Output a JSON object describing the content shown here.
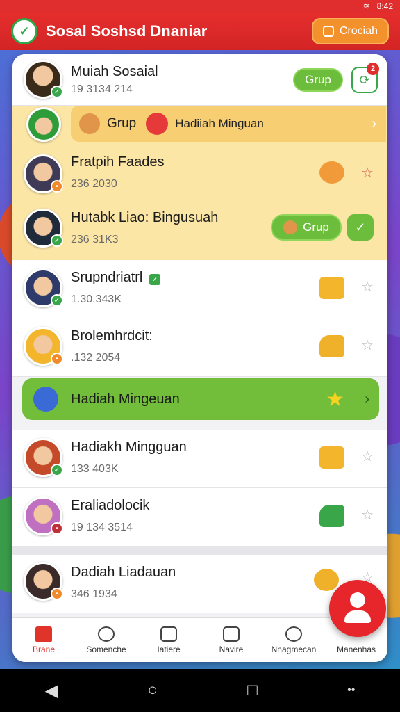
{
  "status": {
    "time": "8:42",
    "wifi_icon": "wifi-icon"
  },
  "app": {
    "title": "Sosal Soshsd Dnaniar",
    "create_label": "Crociah"
  },
  "profile": {
    "name": "Muiah Sosaial",
    "sub": "19 3134 214",
    "group_label": "Grup",
    "badge": "2"
  },
  "reward_bar": {
    "group_label": "Grup",
    "label": "Hadiiah Minguan"
  },
  "rows": [
    {
      "name": "Fratpih Faades",
      "sub": "236 2030"
    },
    {
      "name": "Hutabk Liao: Bingusuah",
      "sub": "236 31K3",
      "group_label": "Grup"
    },
    {
      "name": "Srupndriatrl",
      "sub": "1.30.343K"
    },
    {
      "name": "Brolemhrdcit:",
      "sub": ".132 2054"
    },
    {
      "name": "Hadiakh Mingguan",
      "sub": "133 403K"
    },
    {
      "name": "Eraliadolocik",
      "sub": "19 134 3514"
    },
    {
      "name": "Dadiah Liadauan",
      "sub": "346 1934"
    }
  ],
  "green_bar": {
    "label": "Hadiah Mingeuan"
  },
  "nav": [
    {
      "label": "Brane",
      "icon": "home-icon"
    },
    {
      "label": "Somenche",
      "icon": "search-icon"
    },
    {
      "label": "Iatiere",
      "icon": "list-icon"
    },
    {
      "label": "Navire",
      "icon": "house-icon"
    },
    {
      "label": "Nnagmecan",
      "icon": "chat-icon"
    },
    {
      "label": "Manenhas",
      "icon": "profile-icon"
    }
  ],
  "colors": {
    "brand": "#e02d2d",
    "accent": "#6cbd3b",
    "gold": "#f3b52c"
  }
}
